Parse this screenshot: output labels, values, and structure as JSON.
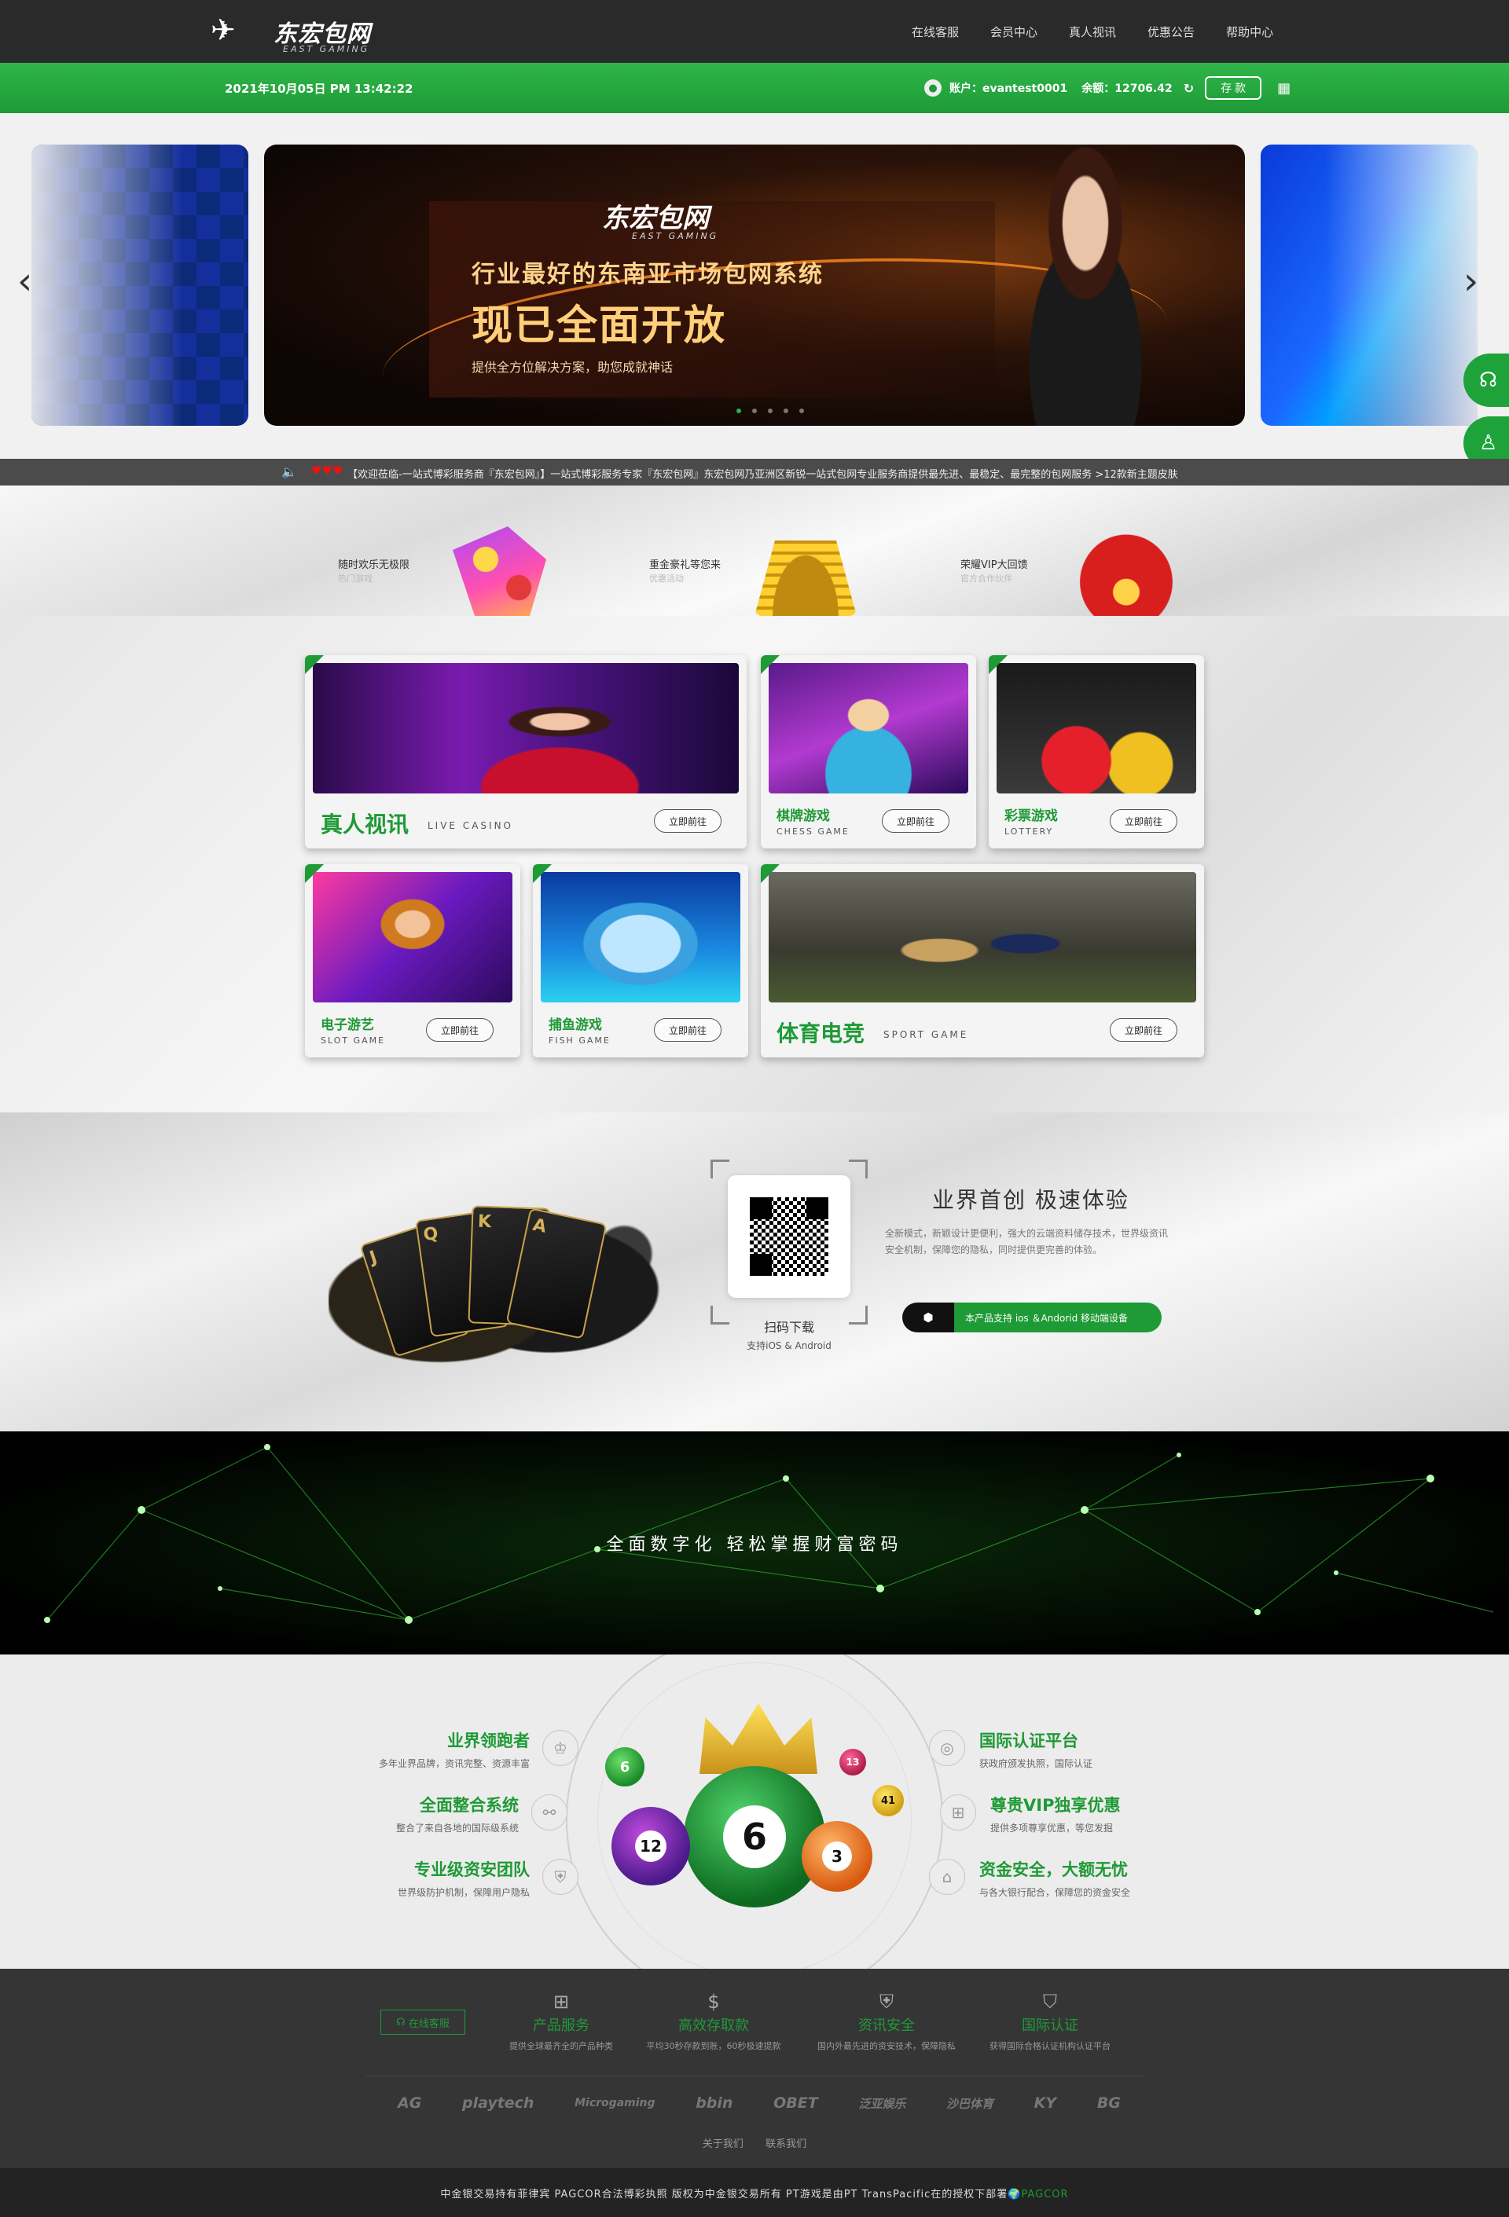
{
  "header": {
    "logo_text": "东宏包网",
    "logo_sub": "EAST GAMING",
    "nav": [
      "在线客服",
      "会员中心",
      "真人视讯",
      "优惠公告",
      "帮助中心"
    ]
  },
  "bar": {
    "datetime": "2021年10月05日 PM 13:42:22",
    "account_label": "账户：evantest0001",
    "balance_label": "余额：12706.42",
    "deposit": "存 款"
  },
  "banner": {
    "logo_text": "东宏包网",
    "logo_sub": "EAST GAMING",
    "line1": "行业最好的东南亚市场包网系统",
    "line2": "现已全面开放",
    "line3": "提供全方位解决方案，助您成就神话",
    "dots": 5,
    "active_dot": 0
  },
  "marquee": {
    "text": "【欢迎莅临-一站式博彩服务商『东宏包网』】一站式博彩服务专家『东宏包网』东宏包网乃亚洲区新锐一站式包网专业服务商提供最先进、最稳定、最完整的包网服务 >12款新主题皮肤"
  },
  "features": [
    {
      "title": "随时欢乐无极限",
      "sub": "热门游戏"
    },
    {
      "title": "重金豪礼等您来",
      "sub": "优惠活动"
    },
    {
      "title": "荣耀VIP大回馈",
      "sub": "官方合作伙伴"
    }
  ],
  "games": {
    "go_label": "立即前往",
    "live": {
      "name": "真人视讯",
      "en": "LIVE CASINO"
    },
    "chess": {
      "name": "棋牌游戏",
      "en": "CHESS GAME"
    },
    "lottery": {
      "name": "彩票游戏",
      "en": "LOTTERY"
    },
    "slot": {
      "name": "电子游艺",
      "en": "SLOT GAME"
    },
    "fish": {
      "name": "捕鱼游戏",
      "en": "FISH GAME"
    },
    "sport": {
      "name": "体育电竞",
      "en": "SPORT GAME"
    }
  },
  "app": {
    "qr_title": "扫码下载",
    "qr_sub": "支持iOS & Android",
    "title": "业界首创 极速体验",
    "desc": "全新模式，新颖设计更便利，强大的云端资料储存技术，世界级资讯安全机制，保障您的隐私，同时提供更完善的体验。",
    "support": "本产品支持 ios ＆Andorid 移动端设备"
  },
  "green_banner": {
    "text": "全面数字化 轻松掌握财富密码"
  },
  "advantages": {
    "left": [
      {
        "title": "业界领跑者",
        "sub": "多年业界品牌，资讯完整、资源丰富"
      },
      {
        "title": "全面整合系统",
        "sub": "整合了来自各地的国际级系统"
      },
      {
        "title": "专业级资安团队",
        "sub": "世界级防护机制，保障用户隐私"
      }
    ],
    "right": [
      {
        "title": "国际认证平台",
        "sub": "获政府颁发执照，国际认证"
      },
      {
        "title": "尊贵VIP独享优惠",
        "sub": "提供多项尊享优惠，等您发掘"
      },
      {
        "title": "资金安全，大额无忧",
        "sub": "与各大银行配合，保障您的资金安全"
      }
    ],
    "balls": [
      "6",
      "6",
      "12",
      "3",
      "13",
      "41"
    ]
  },
  "footer": {
    "cs_label": "在线客服",
    "services": [
      {
        "title": "产品服务",
        "sub": "提供全球最齐全的产品种类"
      },
      {
        "title": "高效存取款",
        "sub": "平均30秒存款到账，60秒极速提款"
      },
      {
        "title": "资讯安全",
        "sub": "国内外最先进的资安技术，保障隐私"
      },
      {
        "title": "国际认证",
        "sub": "获得国际合格认证机构认证平台"
      }
    ],
    "partners": [
      "AG",
      "playtech",
      "Microgaming",
      "bbin",
      "OBET",
      "泛亚娱乐",
      "沙巴体育",
      "KY",
      "BG"
    ],
    "links": [
      "关于我们",
      "联系我们"
    ]
  },
  "copyright": {
    "text": "中金银交易持有菲律宾 PAGCOR合法博彩执照 版权为中金银交易所有 PT游戏是由PT TransPacific在的授权下部署",
    "brand": "PAGCOR"
  }
}
